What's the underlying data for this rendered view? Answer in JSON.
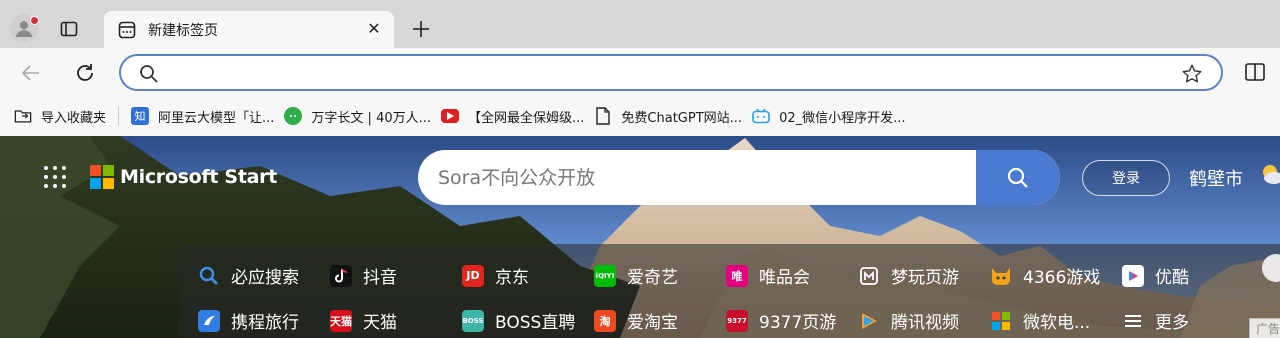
{
  "tab": {
    "title": "新建标签页",
    "close": "✕"
  },
  "omnibox": {
    "value": ""
  },
  "favorites": [
    {
      "label": "导入收藏夹",
      "icon": "import-folder-icon"
    },
    {
      "label": "阿里云大模型「让...",
      "icon": "zhi-icon",
      "icon_text": "知"
    },
    {
      "label": "万字长文 | 40万人...",
      "icon": "wechat-icon"
    },
    {
      "label": "【全网最全保姆级...",
      "icon": "youtube-icon"
    },
    {
      "label": "免费ChatGPT网站...",
      "icon": "page-icon"
    },
    {
      "label": "02_微信小程序开发...",
      "icon": "bilibili-icon"
    }
  ],
  "page": {
    "brand": "Microsoft Start",
    "search_placeholder": "Sora不向公众开放",
    "login": "登录",
    "city": "鹤壁市",
    "ad_label": "广告",
    "links_row1": [
      {
        "label": "必应搜索",
        "icon": "bing-search-icon",
        "color": "#2b7bd6"
      },
      {
        "label": "抖音",
        "icon": "douyin-icon",
        "color": "#111111"
      },
      {
        "label": "京东",
        "icon": "jd-icon",
        "color": "#e1251b",
        "icon_text": "JD"
      },
      {
        "label": "爱奇艺",
        "icon": "iqiyi-icon",
        "color": "#00be06",
        "icon_text": "iQIYI"
      },
      {
        "label": "唯品会",
        "icon": "vip-icon",
        "color": "#e4007f",
        "icon_text": "唯"
      },
      {
        "label": "梦玩页游",
        "icon": "mengwan-icon",
        "color": "#c43b3b"
      },
      {
        "label": "4366游戏",
        "icon": "4366-icon",
        "color": "#f2a31b"
      },
      {
        "label": "优酷",
        "icon": "youku-icon",
        "color": "#2a9ee8"
      }
    ],
    "links_row2": [
      {
        "label": "携程旅行",
        "icon": "ctrip-icon",
        "color": "#2f7de1"
      },
      {
        "label": "天猫",
        "icon": "tmall-icon",
        "color": "#d80f1a",
        "icon_text": "天猫"
      },
      {
        "label": "BOSS直聘",
        "icon": "boss-icon",
        "color": "#3db5a8",
        "icon_text": "BOSS"
      },
      {
        "label": "爱淘宝",
        "icon": "aitaobao-icon",
        "color": "#ef4a1f",
        "icon_text": "淘"
      },
      {
        "label": "9377页游",
        "icon": "9377-icon",
        "color": "#c8102e",
        "icon_text": "9377"
      },
      {
        "label": "腾讯视频",
        "icon": "tencent-video-icon",
        "color": "#2aa4f4"
      },
      {
        "label": "微软电...",
        "icon": "ms-store-icon",
        "color": "#3a8fd9"
      },
      {
        "label": "更多",
        "icon": "menu-icon",
        "color": "transparent"
      }
    ]
  }
}
